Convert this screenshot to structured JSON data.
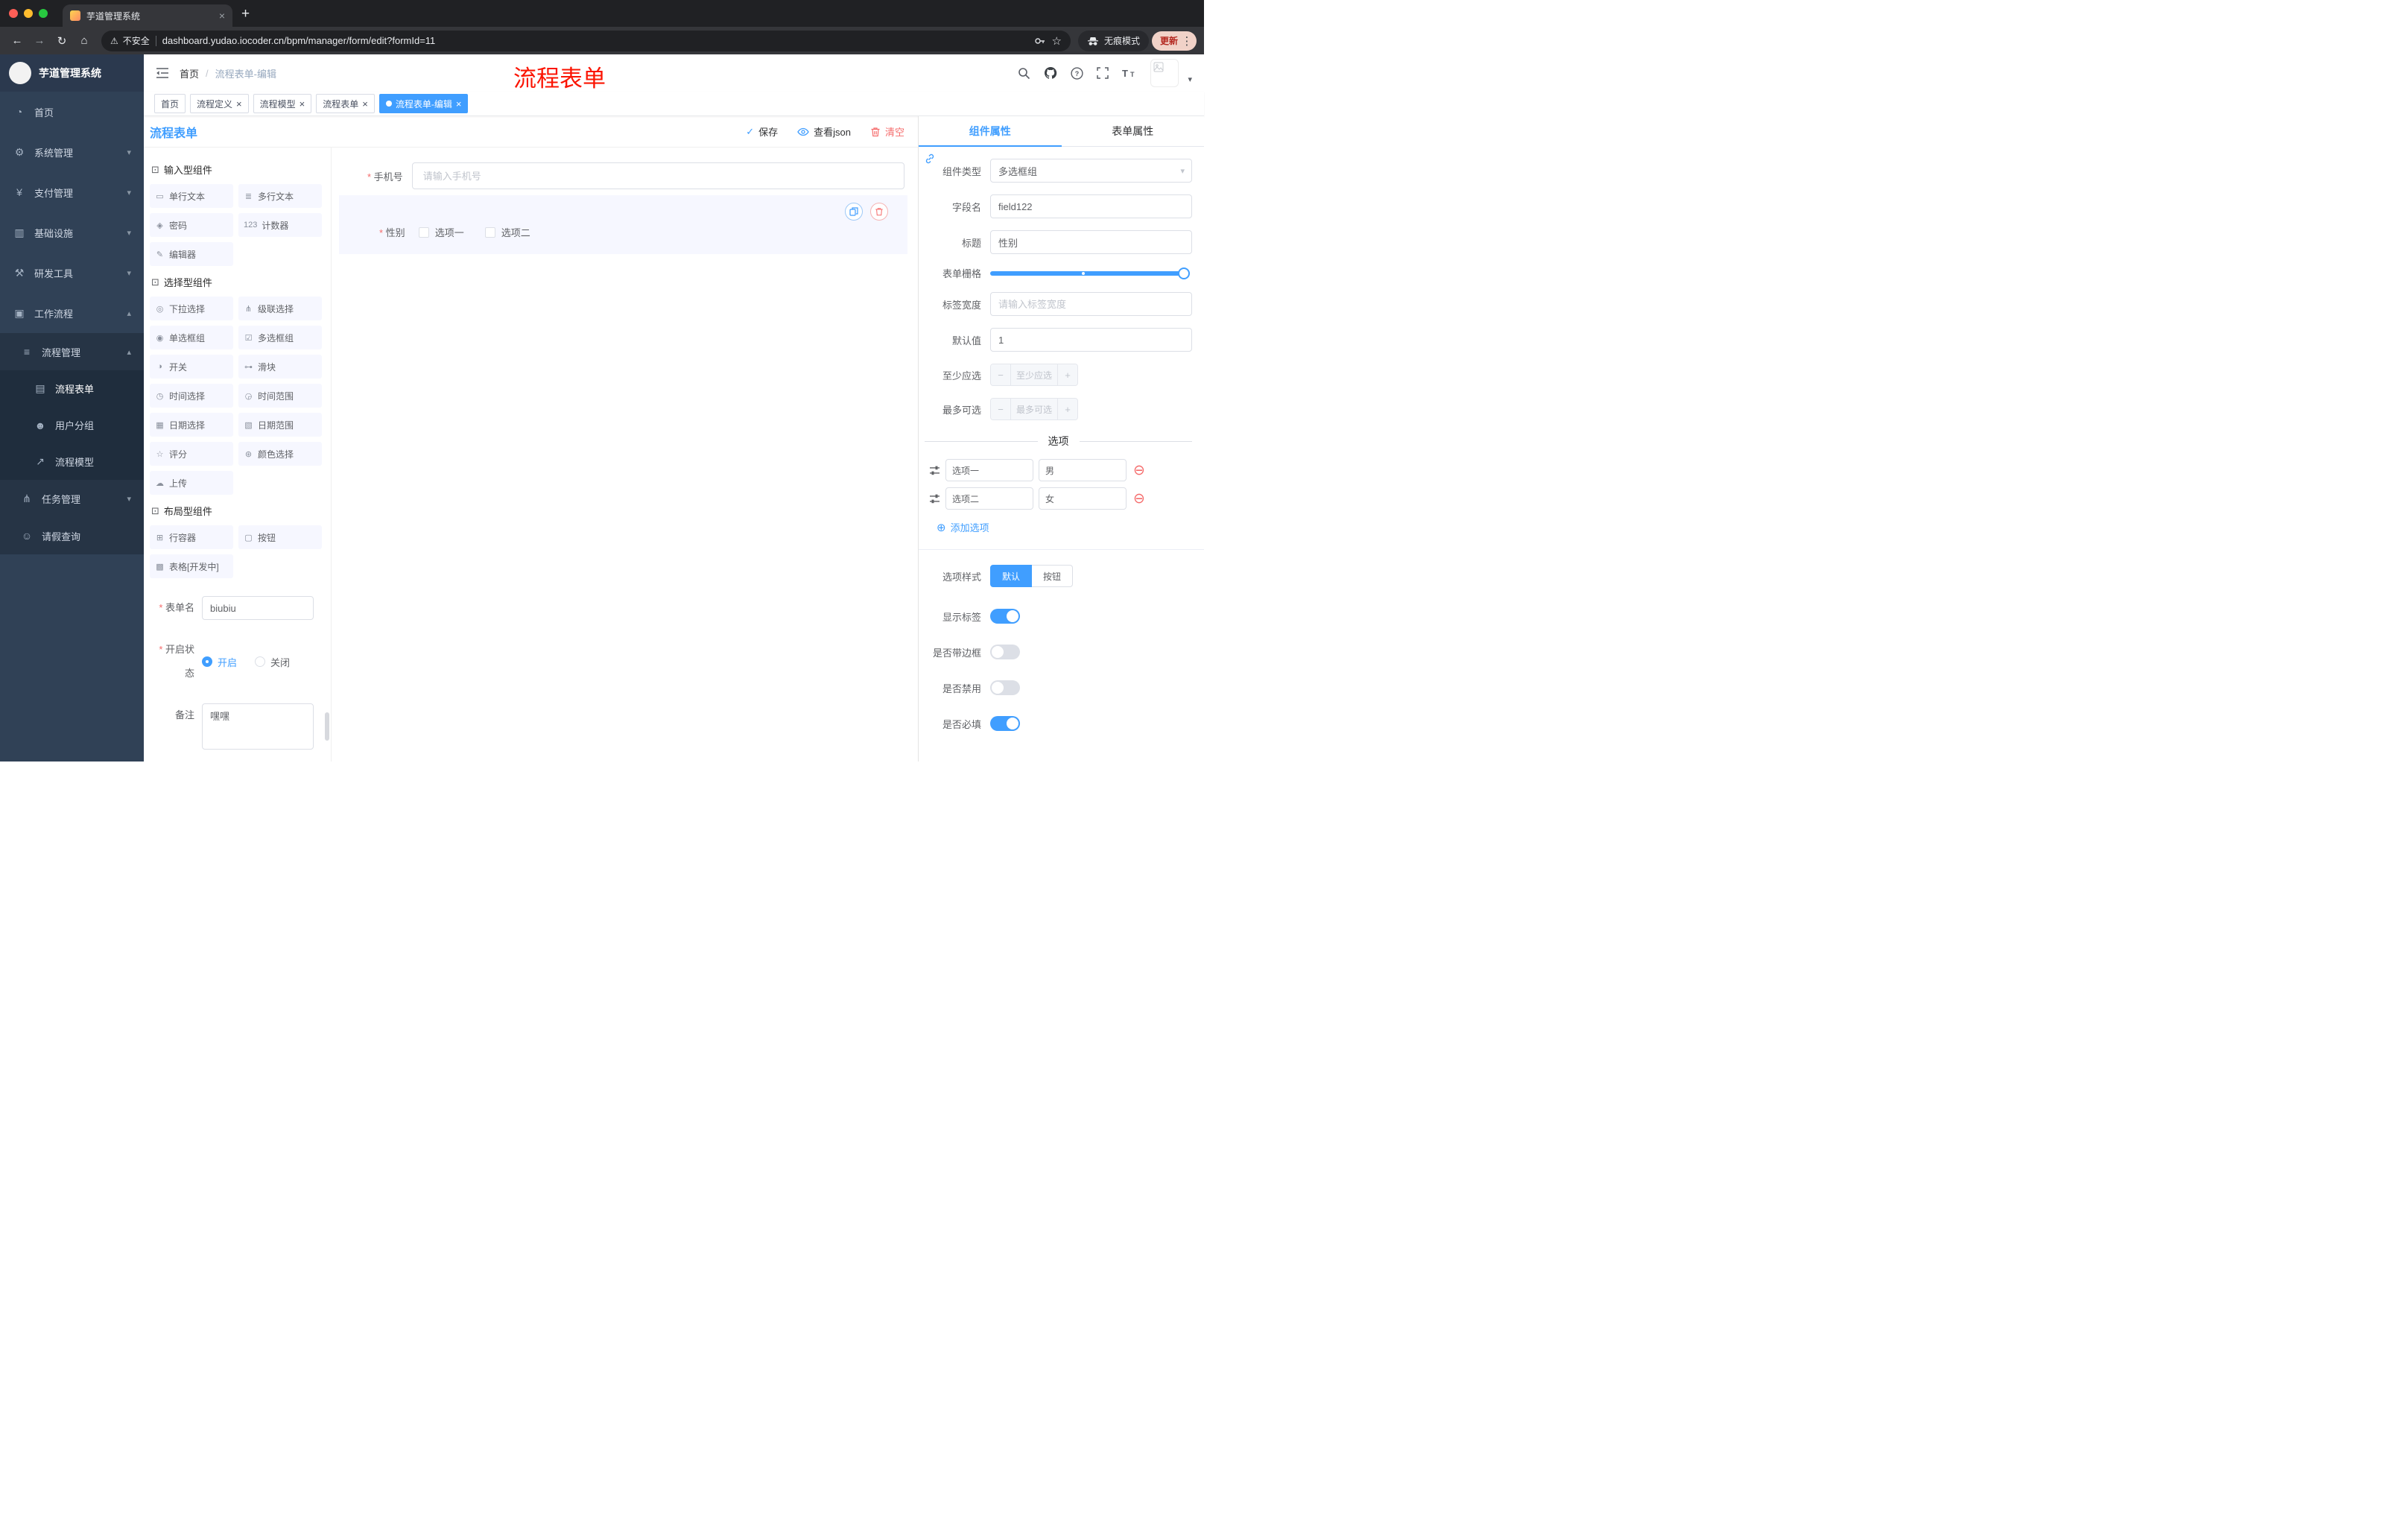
{
  "overlay": {
    "title": "流程表单"
  },
  "browser": {
    "tab_title": "芋道管理系统",
    "security_label": "不安全",
    "url": "dashboard.yudao.iocoder.cn/bpm/manager/form/edit?formId=11",
    "incognito_label": "无痕模式",
    "update_label": "更新"
  },
  "icons": {
    "close": "×",
    "plus": "+",
    "back": "←",
    "forward": "→",
    "reload": "↻",
    "home": "⌂",
    "warning": "⚠",
    "star": "☆",
    "menu_dots": "⋮",
    "chevron_down": "▾",
    "chevron_up": "▴",
    "select_caret": "▾",
    "check": "✓",
    "minus": "−",
    "remove_circle": "⊖",
    "add_circle": "⊕",
    "breadcrumb_sep": "/",
    "section_cube": "⊡"
  },
  "sidebar": {
    "app_title": "芋道管理系统",
    "menu": [
      {
        "label": "首页",
        "glyph": "◔"
      },
      {
        "label": "系统管理",
        "glyph": "⚙"
      },
      {
        "label": "支付管理",
        "glyph": "¥"
      },
      {
        "label": "基础设施",
        "glyph": "▥"
      },
      {
        "label": "研发工具",
        "glyph": "⚒"
      },
      {
        "label": "工作流程",
        "glyph": "▣"
      }
    ],
    "workflow": {
      "process_mgmt": {
        "label": "流程管理",
        "glyph": "≡"
      },
      "children": [
        {
          "label": "流程表单",
          "glyph": "▤"
        },
        {
          "label": "用户分组",
          "glyph": "☻"
        },
        {
          "label": "流程模型",
          "glyph": "↗"
        }
      ],
      "task_mgmt": {
        "label": "任务管理",
        "glyph": "⋔"
      },
      "leave": {
        "label": "请假查询",
        "glyph": "☺"
      }
    }
  },
  "header": {
    "breadcrumb": {
      "home": "首页",
      "current": "流程表单-编辑"
    }
  },
  "tags": [
    {
      "label": "首页"
    },
    {
      "label": "流程定义"
    },
    {
      "label": "流程模型"
    },
    {
      "label": "流程表单"
    },
    {
      "label": "流程表单-编辑"
    }
  ],
  "designer": {
    "title": "流程表单",
    "actions": {
      "save": "保存",
      "view_json": "查看json",
      "clear": "清空"
    },
    "palette": {
      "sections": [
        {
          "title": "输入型组件",
          "items": [
            {
              "label": "单行文本",
              "glyph": "▭"
            },
            {
              "label": "多行文本",
              "glyph": "≣"
            },
            {
              "label": "密码",
              "glyph": "◈"
            },
            {
              "label": "计数器",
              "glyph": "123"
            },
            {
              "label": "编辑器",
              "glyph": "✎"
            }
          ]
        },
        {
          "title": "选择型组件",
          "items": [
            {
              "label": "下拉选择",
              "glyph": "◎"
            },
            {
              "label": "级联选择",
              "glyph": "⋔"
            },
            {
              "label": "单选框组",
              "glyph": "◉"
            },
            {
              "label": "多选框组",
              "glyph": "☑"
            },
            {
              "label": "开关",
              "glyph": "◑"
            },
            {
              "label": "滑块",
              "glyph": "⊶"
            },
            {
              "label": "时间选择",
              "glyph": "◷"
            },
            {
              "label": "时间范围",
              "glyph": "◶"
            },
            {
              "label": "日期选择",
              "glyph": "▦"
            },
            {
              "label": "日期范围",
              "glyph": "▧"
            },
            {
              "label": "评分",
              "glyph": "☆"
            },
            {
              "label": "颜色选择",
              "glyph": "⊛"
            },
            {
              "label": "上传",
              "glyph": "☁"
            }
          ]
        },
        {
          "title": "布局型组件",
          "items": [
            {
              "label": "行容器",
              "glyph": "⊞"
            },
            {
              "label": "按钮",
              "glyph": "▢"
            },
            {
              "label": "表格[开发中]",
              "glyph": "▩"
            }
          ]
        }
      ]
    },
    "meta": {
      "name_label": "表单名",
      "name_value": "biubiu",
      "status_label": "开启状态",
      "status_on": "开启",
      "status_off": "关闭",
      "status_checked": "开启",
      "remark_label": "备注",
      "remark_value": "嘿嘿"
    },
    "canvas": {
      "phone": {
        "label": "手机号",
        "placeholder": "请输入手机号"
      },
      "gender": {
        "label": "性别",
        "option1": "选项一",
        "option2": "选项二"
      }
    }
  },
  "props": {
    "tab_component": "组件属性",
    "tab_form": "表单属性",
    "component_type": {
      "label": "组件类型",
      "value": "多选框组"
    },
    "field_name": {
      "label": "字段名",
      "value": "field122"
    },
    "title": {
      "label": "标题",
      "value": "性别"
    },
    "grid": {
      "label": "表单栅格"
    },
    "label_width": {
      "label": "标签宽度",
      "placeholder": "请输入标签宽度"
    },
    "default_value": {
      "label": "默认值",
      "value": "1"
    },
    "min_select": {
      "label": "至少应选",
      "placeholder": "至少应选"
    },
    "max_select": {
      "label": "最多可选",
      "placeholder": "最多可选"
    },
    "options": {
      "divider": "选项",
      "rows": [
        {
          "name": "选项一",
          "value": "男"
        },
        {
          "name": "选项二",
          "value": "女"
        }
      ],
      "add": "添加选项"
    },
    "style": {
      "label": "选项样式",
      "default": "默认",
      "button": "按钮",
      "selected": "默认"
    },
    "switches": {
      "show_label": {
        "label": "显示标签",
        "on": true
      },
      "border": {
        "label": "是否带边框",
        "on": false
      },
      "disabled": {
        "label": "是否禁用",
        "on": false
      },
      "required": {
        "label": "是否必填",
        "on": true
      }
    }
  },
  "colors": {
    "accent": "#409EFF",
    "danger": "#F56C6C",
    "sidebar_bg": "#304156",
    "overlay_red": "#FB1402"
  }
}
